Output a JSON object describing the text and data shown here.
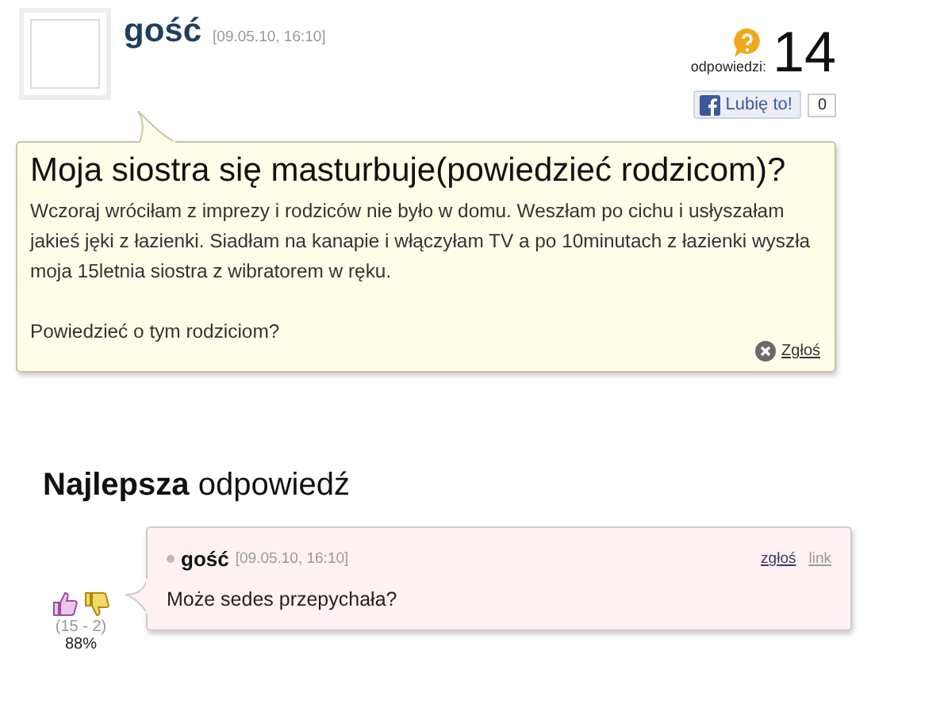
{
  "question": {
    "author": "gość",
    "date": "[09.05.10, 16:10]",
    "answers_label": "odpowiedzi:",
    "answers_count": "14",
    "like_label": "Lubię to!",
    "like_count": "0",
    "title": "Moja siostra się masturbuje(powiedzieć rodzicom)?",
    "body": "Wczoraj wróciłam z imprezy i rodziców nie było w domu. Weszłam po cichu i usłyszałam jakieś jęki z łazienki. Siadłam na kanapie i włączyłam TV a po 10minutach z łazienki wyszła moja 15letnia siostra z wibratorem w ręku.",
    "closing": "Powiedzieć o tym rodziciom?",
    "report": "Zgłoś"
  },
  "best_answer": {
    "heading_bold": "Najlepsza",
    "heading_rest": "odpowiedź",
    "author": "gość",
    "date": "[09.05.10, 16:10]",
    "report": "zgłoś",
    "link": "link",
    "text": "Może sedes przepychała?",
    "votes": "(15 - 2)",
    "percent": "88%"
  }
}
